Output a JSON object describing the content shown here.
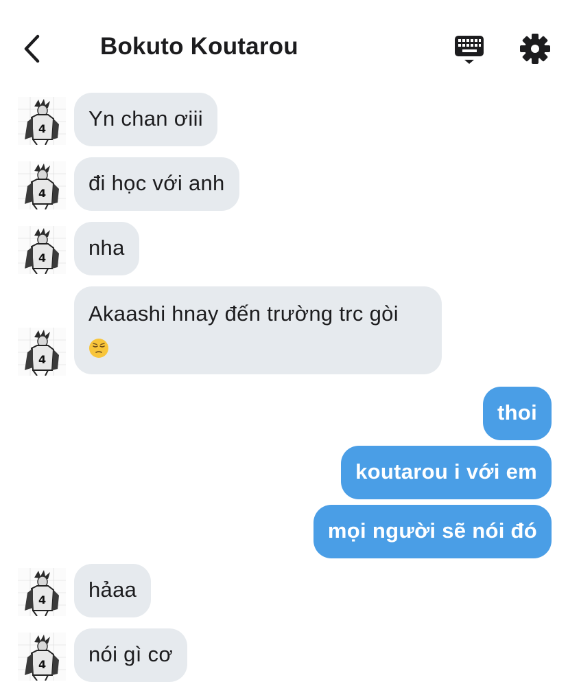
{
  "header": {
    "title": "Bokuto Koutarou",
    "back_icon": "chevron-left-icon",
    "keyboard_icon": "keyboard-icon",
    "settings_icon": "gear-icon"
  },
  "colors": {
    "incoming_bubble": "#e6eaee",
    "outgoing_bubble": "#4a9ee6",
    "text": "#1c1c1e"
  },
  "messages": [
    {
      "side": "in",
      "text": "Yn chan ơiii"
    },
    {
      "side": "in",
      "text": "đi học với anh"
    },
    {
      "side": "in",
      "text": "nha"
    },
    {
      "side": "in",
      "text": "Akaashi hnay đến trường trc gòi",
      "emoji": "pensive-face-emoji"
    },
    {
      "side": "out",
      "text": "thoi"
    },
    {
      "side": "out",
      "text": "koutarou i với em"
    },
    {
      "side": "out",
      "text": "mọi người sẽ nói đó"
    },
    {
      "side": "in",
      "text": "hảaa"
    },
    {
      "side": "in",
      "text": "nói gì cơ"
    }
  ]
}
